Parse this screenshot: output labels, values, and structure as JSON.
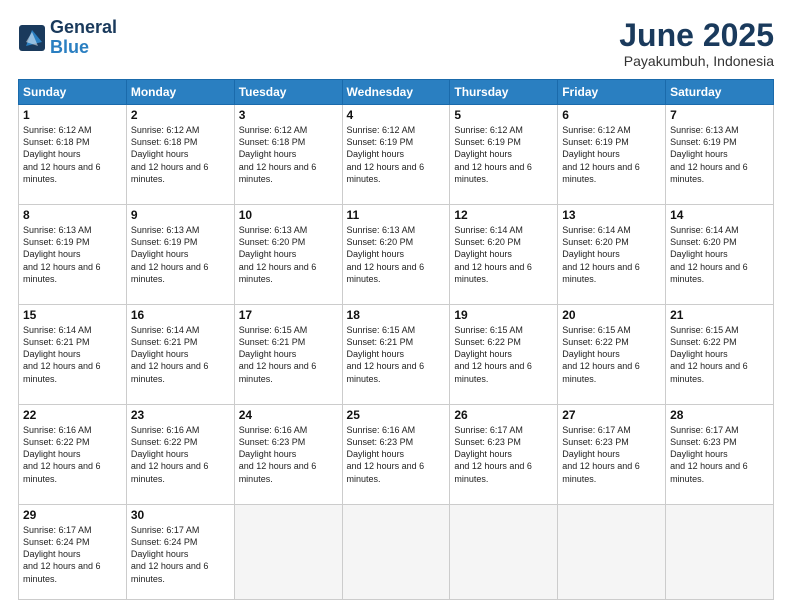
{
  "logo": {
    "line1": "General",
    "line2": "Blue"
  },
  "header": {
    "month": "June 2025",
    "location": "Payakumbuh, Indonesia"
  },
  "weekdays": [
    "Sunday",
    "Monday",
    "Tuesday",
    "Wednesday",
    "Thursday",
    "Friday",
    "Saturday"
  ],
  "weeks": [
    [
      {
        "day": "1",
        "sunrise": "6:12 AM",
        "sunset": "6:18 PM",
        "daylight": "12 hours and 6 minutes."
      },
      {
        "day": "2",
        "sunrise": "6:12 AM",
        "sunset": "6:18 PM",
        "daylight": "12 hours and 6 minutes."
      },
      {
        "day": "3",
        "sunrise": "6:12 AM",
        "sunset": "6:18 PM",
        "daylight": "12 hours and 6 minutes."
      },
      {
        "day": "4",
        "sunrise": "6:12 AM",
        "sunset": "6:19 PM",
        "daylight": "12 hours and 6 minutes."
      },
      {
        "day": "5",
        "sunrise": "6:12 AM",
        "sunset": "6:19 PM",
        "daylight": "12 hours and 6 minutes."
      },
      {
        "day": "6",
        "sunrise": "6:12 AM",
        "sunset": "6:19 PM",
        "daylight": "12 hours and 6 minutes."
      },
      {
        "day": "7",
        "sunrise": "6:13 AM",
        "sunset": "6:19 PM",
        "daylight": "12 hours and 6 minutes."
      }
    ],
    [
      {
        "day": "8",
        "sunrise": "6:13 AM",
        "sunset": "6:19 PM",
        "daylight": "12 hours and 6 minutes."
      },
      {
        "day": "9",
        "sunrise": "6:13 AM",
        "sunset": "6:19 PM",
        "daylight": "12 hours and 6 minutes."
      },
      {
        "day": "10",
        "sunrise": "6:13 AM",
        "sunset": "6:20 PM",
        "daylight": "12 hours and 6 minutes."
      },
      {
        "day": "11",
        "sunrise": "6:13 AM",
        "sunset": "6:20 PM",
        "daylight": "12 hours and 6 minutes."
      },
      {
        "day": "12",
        "sunrise": "6:14 AM",
        "sunset": "6:20 PM",
        "daylight": "12 hours and 6 minutes."
      },
      {
        "day": "13",
        "sunrise": "6:14 AM",
        "sunset": "6:20 PM",
        "daylight": "12 hours and 6 minutes."
      },
      {
        "day": "14",
        "sunrise": "6:14 AM",
        "sunset": "6:20 PM",
        "daylight": "12 hours and 6 minutes."
      }
    ],
    [
      {
        "day": "15",
        "sunrise": "6:14 AM",
        "sunset": "6:21 PM",
        "daylight": "12 hours and 6 minutes."
      },
      {
        "day": "16",
        "sunrise": "6:14 AM",
        "sunset": "6:21 PM",
        "daylight": "12 hours and 6 minutes."
      },
      {
        "day": "17",
        "sunrise": "6:15 AM",
        "sunset": "6:21 PM",
        "daylight": "12 hours and 6 minutes."
      },
      {
        "day": "18",
        "sunrise": "6:15 AM",
        "sunset": "6:21 PM",
        "daylight": "12 hours and 6 minutes."
      },
      {
        "day": "19",
        "sunrise": "6:15 AM",
        "sunset": "6:22 PM",
        "daylight": "12 hours and 6 minutes."
      },
      {
        "day": "20",
        "sunrise": "6:15 AM",
        "sunset": "6:22 PM",
        "daylight": "12 hours and 6 minutes."
      },
      {
        "day": "21",
        "sunrise": "6:15 AM",
        "sunset": "6:22 PM",
        "daylight": "12 hours and 6 minutes."
      }
    ],
    [
      {
        "day": "22",
        "sunrise": "6:16 AM",
        "sunset": "6:22 PM",
        "daylight": "12 hours and 6 minutes."
      },
      {
        "day": "23",
        "sunrise": "6:16 AM",
        "sunset": "6:22 PM",
        "daylight": "12 hours and 6 minutes."
      },
      {
        "day": "24",
        "sunrise": "6:16 AM",
        "sunset": "6:23 PM",
        "daylight": "12 hours and 6 minutes."
      },
      {
        "day": "25",
        "sunrise": "6:16 AM",
        "sunset": "6:23 PM",
        "daylight": "12 hours and 6 minutes."
      },
      {
        "day": "26",
        "sunrise": "6:17 AM",
        "sunset": "6:23 PM",
        "daylight": "12 hours and 6 minutes."
      },
      {
        "day": "27",
        "sunrise": "6:17 AM",
        "sunset": "6:23 PM",
        "daylight": "12 hours and 6 minutes."
      },
      {
        "day": "28",
        "sunrise": "6:17 AM",
        "sunset": "6:23 PM",
        "daylight": "12 hours and 6 minutes."
      }
    ],
    [
      {
        "day": "29",
        "sunrise": "6:17 AM",
        "sunset": "6:24 PM",
        "daylight": "12 hours and 6 minutes."
      },
      {
        "day": "30",
        "sunrise": "6:17 AM",
        "sunset": "6:24 PM",
        "daylight": "12 hours and 6 minutes."
      },
      null,
      null,
      null,
      null,
      null
    ]
  ]
}
